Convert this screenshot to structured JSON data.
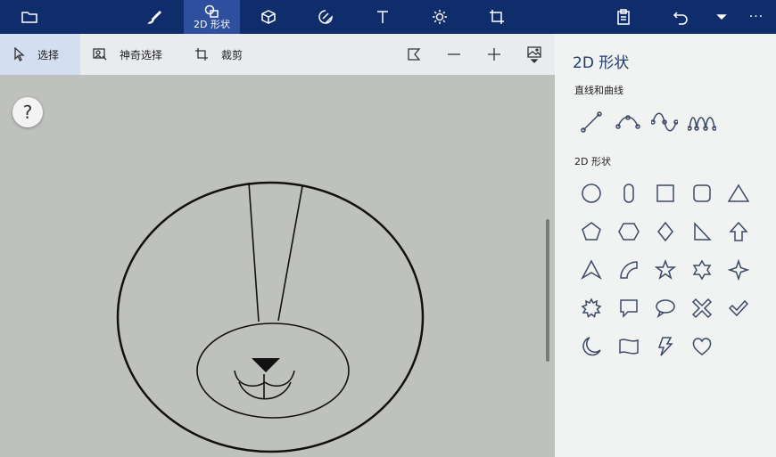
{
  "topbar": {
    "active_tab_label": "2D 形状",
    "icons": [
      "folder-icon",
      "brush-icon",
      "2d-shapes-icon",
      "3d-shapes-icon",
      "stickers-icon",
      "text-icon",
      "effects-icon",
      "canvas-icon",
      "paste-icon",
      "undo-icon",
      "dropdown-icon",
      "more-icon"
    ]
  },
  "toolbar": {
    "select_label": "选择",
    "magic_select_label": "神奇选择",
    "crop_label": "裁剪"
  },
  "canvas": {
    "help_label": "?"
  },
  "panel": {
    "title": "2D 形状",
    "lines_section": "直线和曲线",
    "shapes_section": "2D 形状"
  },
  "colors": {
    "topbar": "#0f2c6b",
    "active_tab": "#2d4f9e",
    "panel_bg": "#f1f2f2",
    "canvas_bg": "#bfc1bd"
  }
}
